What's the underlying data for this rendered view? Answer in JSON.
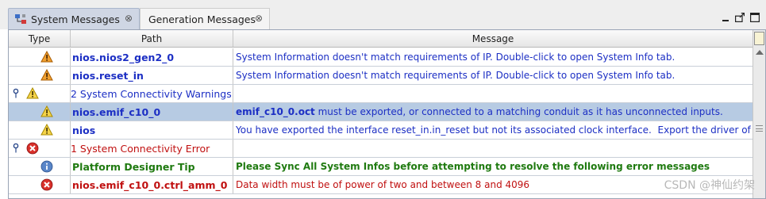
{
  "tabs": [
    {
      "label": "System Messages",
      "close": "⊗",
      "active": true
    },
    {
      "label": "Generation Messages",
      "close": "⊗",
      "active": false
    }
  ],
  "table": {
    "columns": [
      "Type",
      "Path",
      "Message"
    ],
    "rows": [
      {
        "kind": "warning",
        "path": "nios.nios2_gen2_0",
        "message": "System Information doesn't match requirements of IP. Double-click to open System Info tab."
      },
      {
        "kind": "warning",
        "path": "nios.reset_in",
        "message": "System Information doesn't match requirements of IP. Double-click to open System Info tab."
      },
      {
        "kind": "warning-group",
        "label": "2 System Connectivity Warnings"
      },
      {
        "kind": "warning",
        "path": "nios.emif_c10_0",
        "message_bold": "emif_c10_0.oct",
        "message": " must be exported, or connected to a matching conduit as it has unconnected inputs.",
        "selected": true
      },
      {
        "kind": "warning",
        "path": "nios",
        "message": "You have exported the interface reset_in.in_reset but not its associated clock interface.  Export the driver of reset_in.clk"
      },
      {
        "kind": "error-group",
        "label": "1 System Connectivity Error"
      },
      {
        "kind": "info",
        "path": "Platform Designer Tip",
        "message": "Please Sync All System Infos before attempting to resolve the following error messages"
      },
      {
        "kind": "error",
        "path": "nios.emif_c10_0.ctrl_amm_0",
        "message": "Data width must be of power of two and between 8 and 4096"
      }
    ]
  },
  "watermark": "CSDN @神仙约架",
  "colors": {
    "blue_text": "#1c2fc4",
    "error_text": "#c01010",
    "tip_text": "#1f7a10",
    "selected_row": "#b7cbe3"
  },
  "icons": {
    "warning": "warning-triangle-icon",
    "error": "error-circle-icon",
    "info": "info-circle-icon",
    "pin": "pin-icon"
  }
}
